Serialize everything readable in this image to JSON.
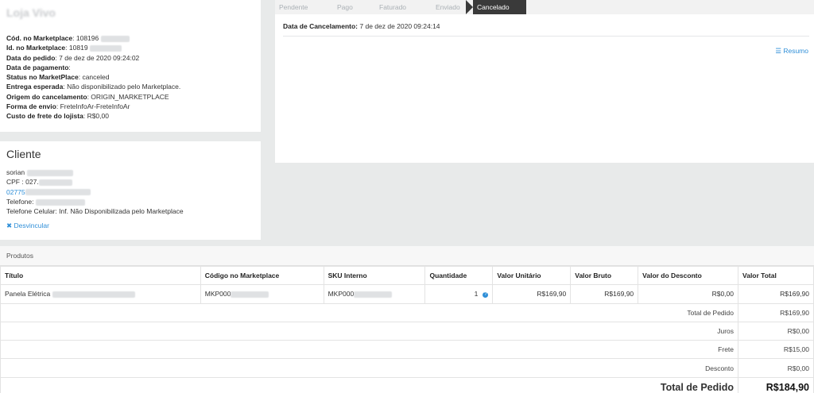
{
  "shop": {
    "name": "Loja Vivo"
  },
  "order_info": [
    {
      "label": "Cód. no Marketplace",
      "value": "108196"
    },
    {
      "label": "Id. no Marketplace",
      "value": "10819"
    },
    {
      "label": "Data do pedido",
      "value": "7 de dez de 2020 09:24:02"
    },
    {
      "label": "Data de pagamento",
      "value": ""
    },
    {
      "label": "Status no MarketPlace",
      "value": "canceled"
    },
    {
      "label": "Entrega esperada",
      "value": "Não disponibilizado pelo Marketplace."
    },
    {
      "label": "Origem do cancelamento",
      "value": "ORIGIN_MARKETPLACE"
    },
    {
      "label": "Forma de envio",
      "value": "FreteInfoAr-FreteInfoAr"
    },
    {
      "label": "Custo de frete do lojista",
      "value": "R$0,00"
    }
  ],
  "steps": [
    "Pendente",
    "Pago",
    "Faturado",
    "Enviado",
    "Cancelado"
  ],
  "cancel": {
    "label": "Data de Cancelamento:",
    "value": "7 de dez de 2020 09:24:14"
  },
  "resumo_label": "Resumo",
  "client": {
    "title": "Cliente",
    "name": "sorian",
    "cpf_label": "CPF :",
    "cpf_value": "027.",
    "email": "02775",
    "phone_label": "Telefone:",
    "cell_line": "Telefone Celular: Inf. Não Disponibilizada pelo Marketplace",
    "unlink": "Desvincular"
  },
  "products": {
    "section_title": "Produtos",
    "columns": [
      "Título",
      "Código no Marketplace",
      "SKU Interno",
      "Quantidade",
      "Valor Unitário",
      "Valor Bruto",
      "Valor do Desconto",
      "Valor Total"
    ],
    "row": {
      "title": "Panela Elétrica",
      "code": "MKP000",
      "sku": "MKP000",
      "qty": "1",
      "unit": "R$169,90",
      "gross": "R$169,90",
      "discount": "R$0,00",
      "total": "R$169,90"
    },
    "summary": [
      {
        "label": "Total de Pedido",
        "value": "R$169,90"
      },
      {
        "label": "Juros",
        "value": "R$0,00"
      },
      {
        "label": "Frete",
        "value": "R$15,00"
      },
      {
        "label": "Desconto",
        "value": "R$0,00"
      }
    ],
    "grand_total": {
      "label": "Total de Pedido",
      "value": "R$184,90"
    }
  },
  "colors": {
    "accent": "#2f8fd8",
    "active_step": "#3a3a3a"
  }
}
